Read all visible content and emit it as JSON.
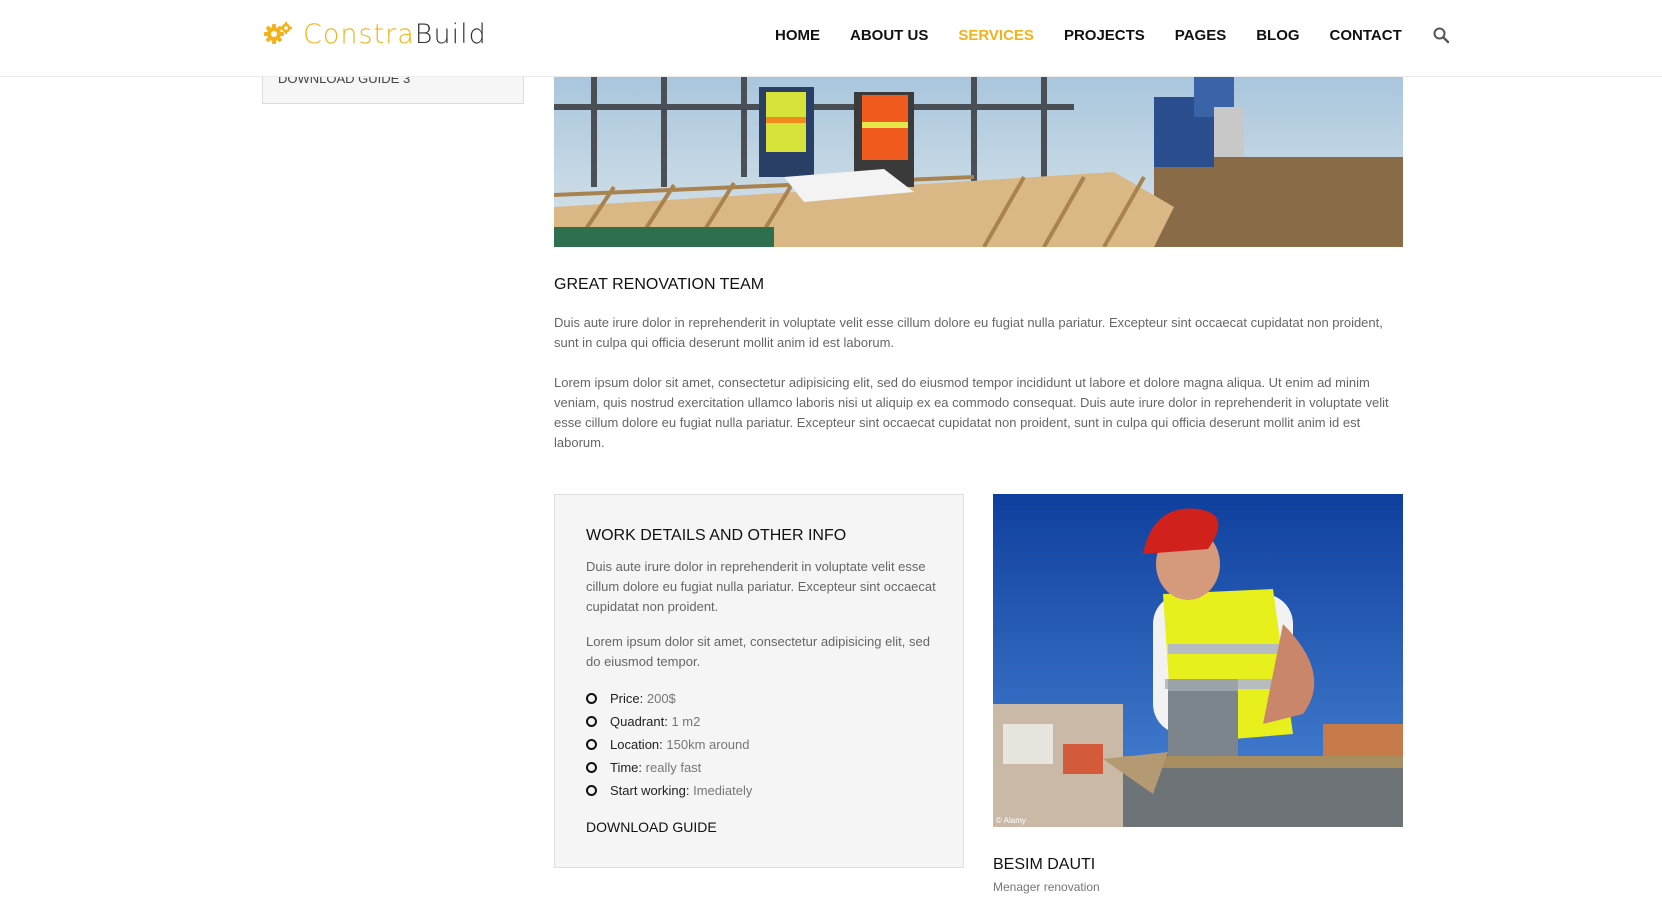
{
  "brand": {
    "name_part1": "Constra",
    "name_part2": "Build",
    "accent_color": "#f2b21b",
    "icon": "gears-icon"
  },
  "nav": {
    "items": [
      "HOME",
      "ABOUT US",
      "SERVICES",
      "PROJECTS",
      "PAGES",
      "BLOG",
      "CONTACT"
    ],
    "active": "SERVICES",
    "search_icon": "search-icon"
  },
  "sidebar": {
    "link": "DOWNLOAD GUIDE 3"
  },
  "main": {
    "title": "GREAT RENOVATION TEAM",
    "para1": "Duis aute irure dolor in reprehenderit in voluptate velit esse cillum dolore eu fugiat nulla pariatur. Excepteur sint occaecat cupidatat non proident, sunt in culpa qui officia deserunt mollit anim id est laborum.",
    "para2": "Lorem ipsum dolor sit amet, consectetur adipisicing elit, sed do eiusmod tempor incididunt ut labore et dolore magna aliqua. Ut enim ad minim veniam, quis nostrud exercitation ullamco laboris nisi ut aliquip ex ea commodo consequat. Duis aute irure dolor in reprehenderit in voluptate velit esse cillum dolore eu fugiat nulla pariatur. Excepteur sint occaecat cupidatat non proident, sunt in culpa qui officia deserunt mollit anim id est laborum."
  },
  "info": {
    "title": "WORK DETAILS AND OTHER INFO",
    "para1": "Duis aute irure dolor in reprehenderit in voluptate velit esse cillum dolore eu fugiat nulla pariatur. Excepteur sint occaecat cupidatat non proident.",
    "para2": "Lorem ipsum dolor sit amet, consectetur adipisicing elit, sed do eiusmod tempor.",
    "details": [
      {
        "label": "Price:",
        "value": "200$"
      },
      {
        "label": "Quadrant:",
        "value": "1 m2"
      },
      {
        "label": "Location:",
        "value": "150km around"
      },
      {
        "label": "Time:",
        "value": "really fast"
      },
      {
        "label": "Start working:",
        "value": "Imediately"
      }
    ],
    "download_label": "DOWNLOAD GUIDE"
  },
  "person": {
    "name": "BESIM DAUTI",
    "role": "Menager renovation",
    "photo_credit": "© Alamy"
  }
}
